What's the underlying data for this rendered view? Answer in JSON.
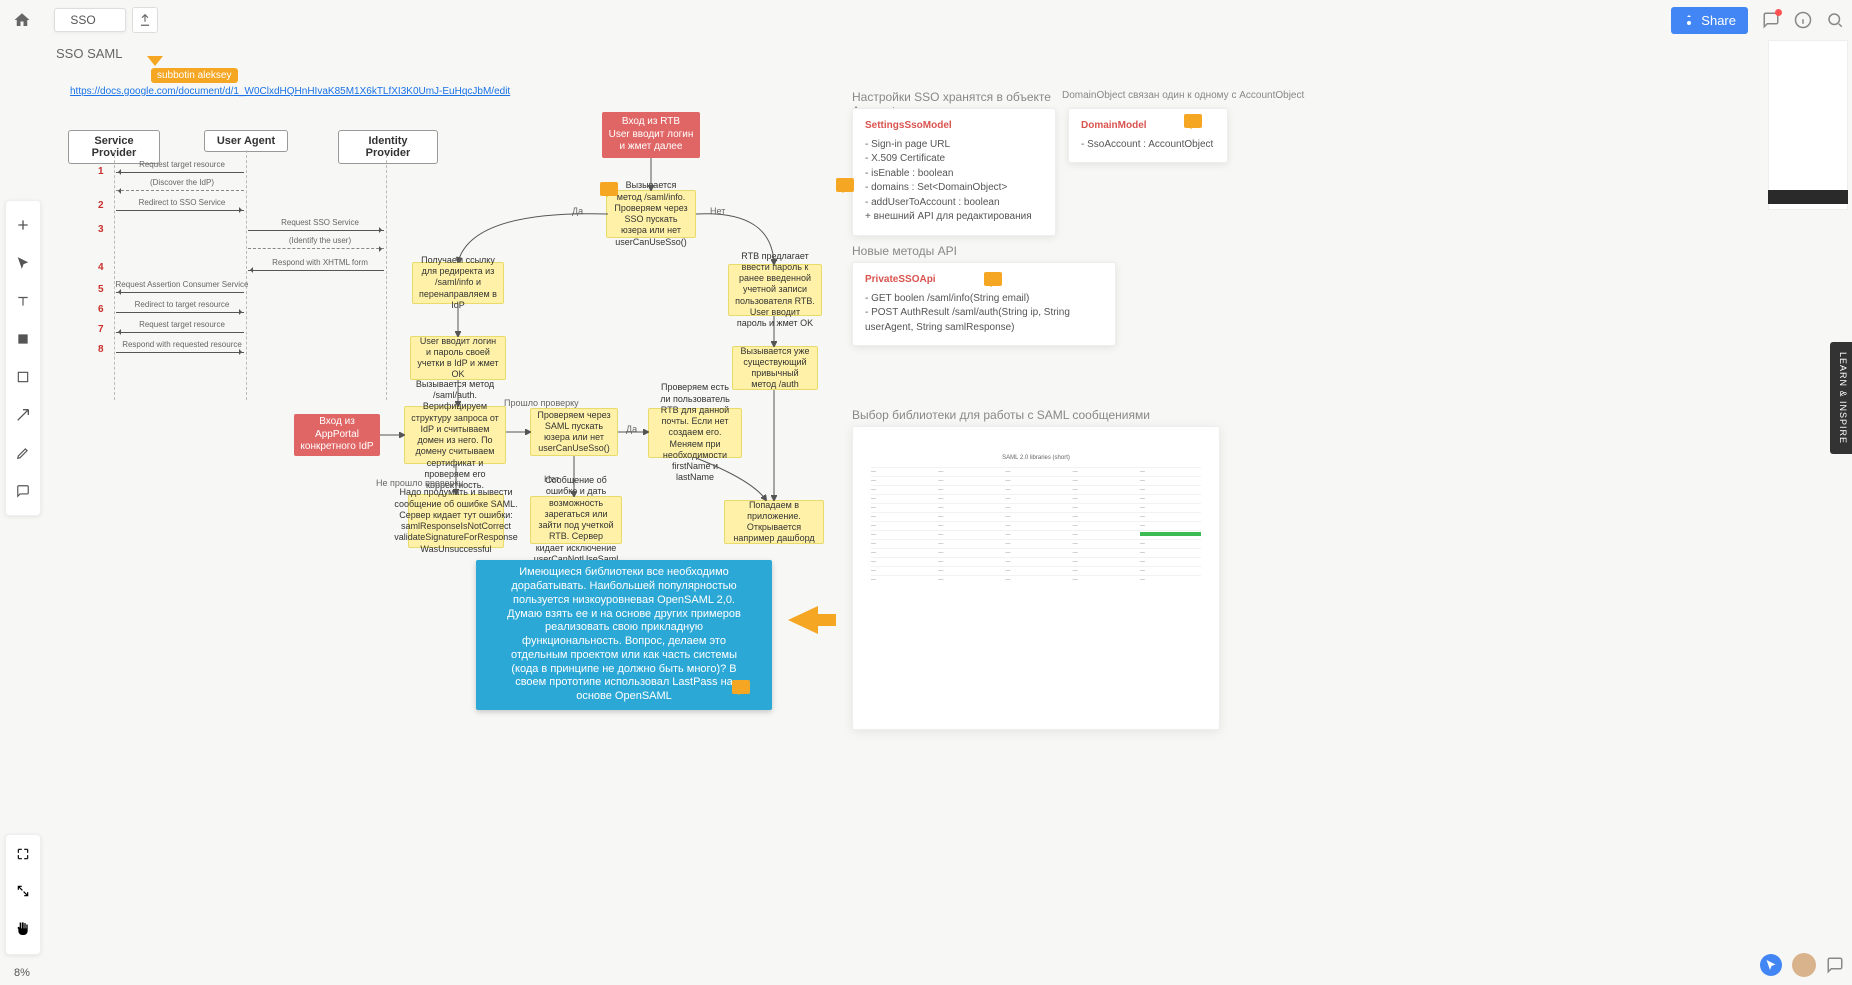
{
  "header": {
    "board_name": "SSO",
    "share_label": "Share"
  },
  "zoom": "8%",
  "learn_tab": "LEARN & INSPIRE",
  "board": {
    "title": "SSO SAML",
    "cursor_user": "subbotin aleksey",
    "link": "https://docs.google.com/document/d/1_W0ClxdHQHnHIvaK85M1X6kTLfXI3K0UmJ-EuHqcJbM/edit"
  },
  "lanes": {
    "sp": "Service Provider",
    "ua": "User Agent",
    "idp": "Identity Provider"
  },
  "seq": {
    "n1": "1",
    "l1": "Request target resource",
    "l1b": "(Discover the IdP)",
    "n2": "2",
    "l2": "Redirect to SSO Service",
    "n3": "3",
    "l3": "Request SSO Service",
    "l3b": "(Identify the user)",
    "n4": "4",
    "l4": "Respond with XHTML form",
    "n5": "5",
    "l5": "Request Assertion Consumer Service",
    "n6": "6",
    "l6": "Redirect to target resource",
    "n7": "7",
    "l7": "Request target resource",
    "n8": "8",
    "l8": "Respond with requested resource"
  },
  "nodes": {
    "rtb_entry": "Вход из RTB\nUser вводит логин\nи жмет далее",
    "saml_info": "Вызывается метод /saml/info. Проверяем через SSO пускать юзера или нет userCanUseSso()",
    "redirect": "Получаем ссылку для редиректа из /saml/info и перенаправляем в IdP",
    "user_creds": "User вводит логин и пароль своей учетки в IdP и жмет OK",
    "app_portal": "Вход из AppPortal конкретного IdP",
    "saml_auth": "Вызывается метод /saml/auth. Верифицируем структуру запроса от IdP и считываем домен из него. По домену считываем сертификат и проверяем его корректность.",
    "check_user": "Проверяем через SAML пускать юзера или нет userCanUseSso()",
    "check_rtb": "Проверяем есть ли пользователь RTB для данной почты. Если нет создаем его. Меняем при необходимости firstName и lastName",
    "rtb_prompt": "RTB предлагает ввести пароль к ранее введенной учетной записи пользователя RTB. User вводит пароль и жмет OK",
    "existing_auth": "Вызывается уже существующий привычный метод /auth",
    "dashboard": "Попадаем в приложение. Открывается например дашборд",
    "err_verify": "Надо продумать и вывести сообщение об ошибке SAML. Сервер кидает тут ошибки: samlResponseIsNotCorrect validateSignatureForResponse WasUnsuccessful",
    "err_register": "Сообщение об ошибке и дать возможность зарегаться или зайти под учеткой RTB. Сервер кидает исключение userCanNotUseSaml",
    "note_blue": "Имеющиеся библиотеки все необходимо дорабатывать. Наибольшей популярностью пользуется низкоуровневая OpenSAML 2,0. Думаю взять ее и на основе других примеров реализовать свою прикладную функциональность. Вопрос, делаем это отдельным проектом или как часть системы (кода в принципе не должно быть много)? В своем прототипе использовал LastPass на основе OpenSAML"
  },
  "edge_labels": {
    "yes": "Да",
    "no": "Нет",
    "passed": "Прошло проверку",
    "failed": "Не прошло проверку"
  },
  "sections": {
    "settings_title": "Настройки SSO хранятся в объекте Account",
    "domain_title": "DomainObject связан один к одному с AccountObject",
    "api_title": "Новые методы API",
    "lib_title": "Выбор библиотеки для работы с SAML сообщениями"
  },
  "cards": {
    "settings": {
      "title": "SettingsSsoModel",
      "lines": [
        "- Sign-in page URL",
        "- X.509 Certificate",
        "- isEnable : boolean",
        "- domains : Set<DomainObject>",
        "- addUserToAccount : boolean",
        "+ внешний API для редактирования"
      ]
    },
    "domain": {
      "title": "DomainModel",
      "lines": [
        "- SsoAccount : AccountObject"
      ]
    },
    "api": {
      "title": "PrivateSSOApi",
      "lines": [
        "- GET boolen /saml/info(String email)",
        "- POST AuthResult /saml/auth(String ip, String userAgent, String samlResponse)"
      ]
    }
  },
  "sheet_title": "SAML 2.0 libraries (short)"
}
